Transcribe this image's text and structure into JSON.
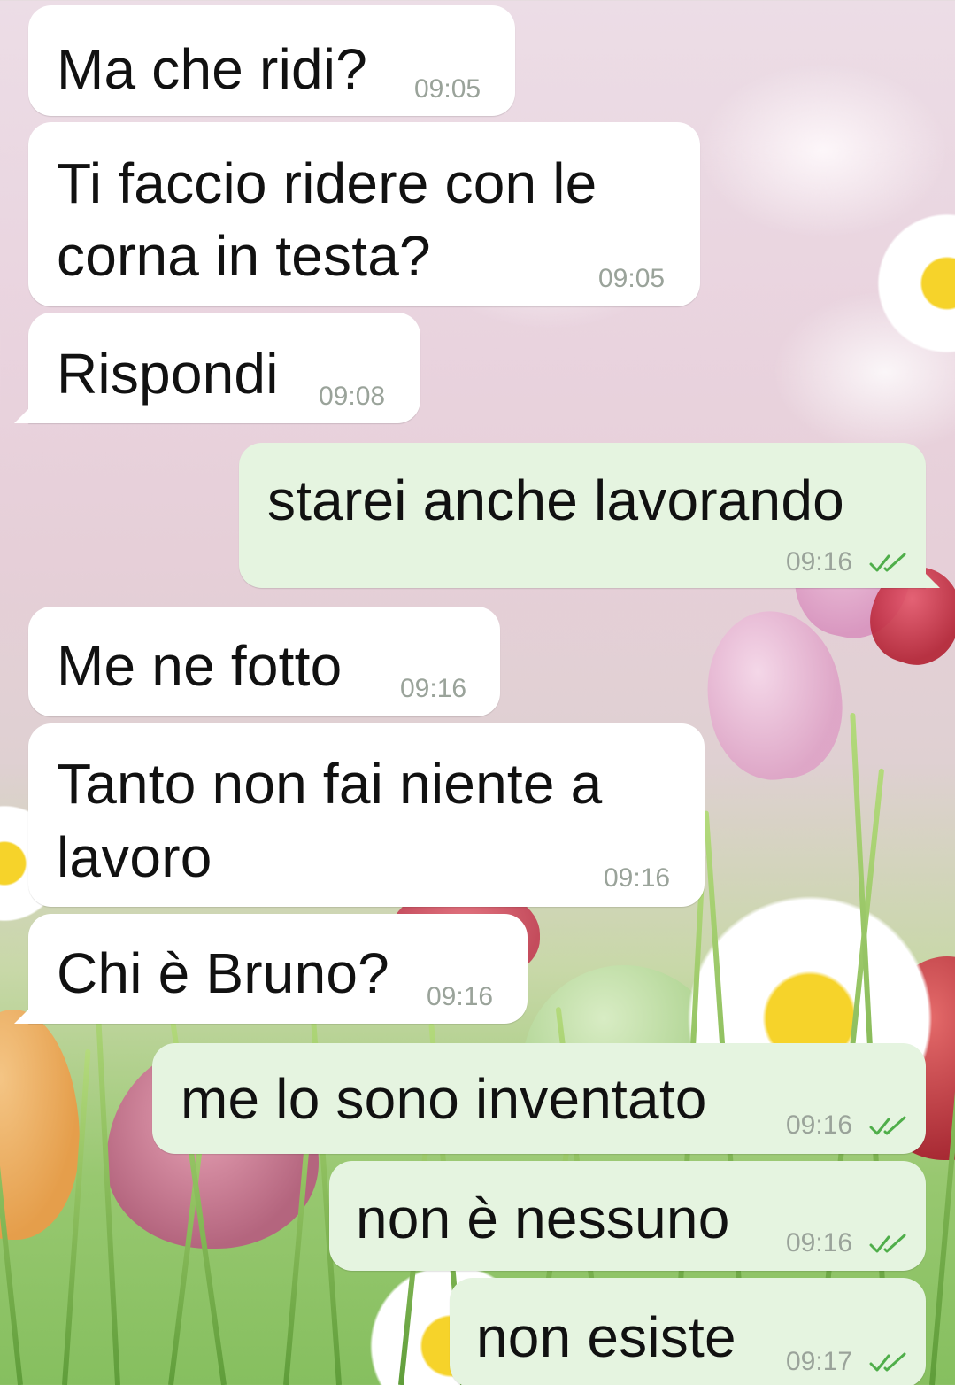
{
  "messages": [
    {
      "direction": "in",
      "text": "Ma che ridi?",
      "time": "09:05"
    },
    {
      "direction": "in",
      "text_lines": [
        "Ti faccio ridere con le",
        "corna in testa?"
      ],
      "time": "09:05"
    },
    {
      "direction": "in",
      "text": "Rispondi",
      "time": "09:08"
    },
    {
      "direction": "out",
      "text": "starei anche lavorando",
      "time": "09:16",
      "status": "read",
      "status_icon": "double-check-icon"
    },
    {
      "direction": "in",
      "text": "Me ne fotto",
      "time": "09:16"
    },
    {
      "direction": "in",
      "text_lines": [
        "Tanto non fai niente a",
        "lavoro"
      ],
      "time": "09:16"
    },
    {
      "direction": "in",
      "text": "Chi è Bruno?",
      "time": "09:16"
    },
    {
      "direction": "out",
      "text": "me lo sono inventato",
      "time": "09:16",
      "status": "read",
      "status_icon": "double-check-icon"
    },
    {
      "direction": "out",
      "text": "non è nessuno",
      "time": "09:16",
      "status": "read",
      "status_icon": "double-check-icon"
    },
    {
      "direction": "out",
      "text": "non esiste",
      "time": "09:17",
      "status": "read",
      "status_icon": "double-check-icon"
    }
  ],
  "colors": {
    "incoming_bubble": "#ffffff",
    "outgoing_bubble": "#e5f4e0",
    "timestamp": "#9aa39a",
    "read_ticks": "#4fae4a"
  }
}
